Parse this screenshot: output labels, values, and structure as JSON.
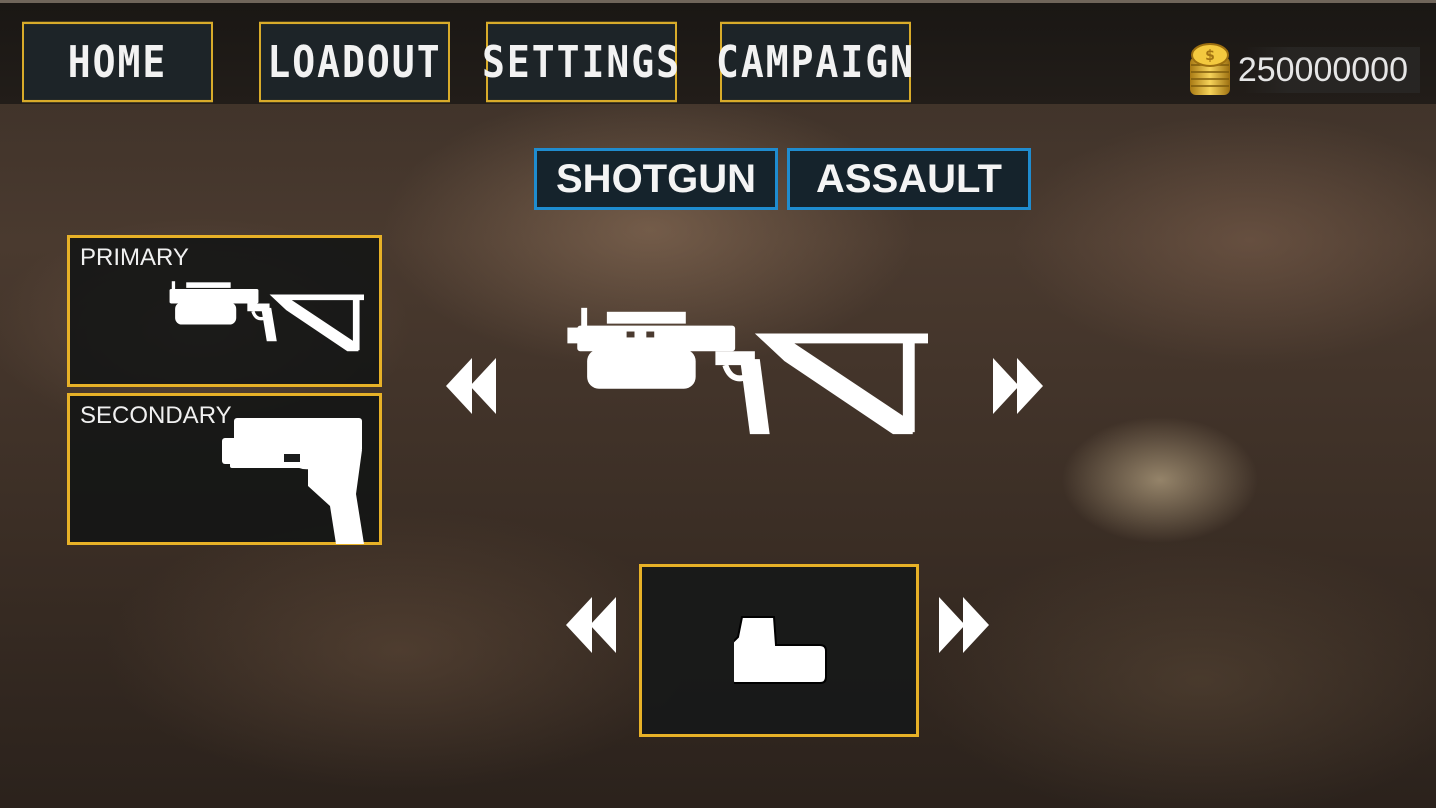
{
  "nav": {
    "home": "HOME",
    "loadout": "LOADOUT",
    "settings": "SETTINGS",
    "campaign": "CAMPAIGN"
  },
  "currency": {
    "value": "250000000",
    "icon": "gold-coins-icon"
  },
  "categories": {
    "shotgun": "SHOTGUN",
    "assault": "ASSAULT"
  },
  "slots": {
    "primary": {
      "label": "PRIMARY",
      "icon": "submachine-gun-icon"
    },
    "secondary": {
      "label": "SECONDARY",
      "icon": "pistol-icon"
    }
  },
  "weapon_viewer": {
    "icon": "submachine-gun-icon"
  },
  "attachment": {
    "icon": "holographic-sight-icon"
  },
  "colors": {
    "slot_border": "#e7b127",
    "tab_border": "#1f8ccf",
    "nav_border": "#d8ab2a"
  }
}
